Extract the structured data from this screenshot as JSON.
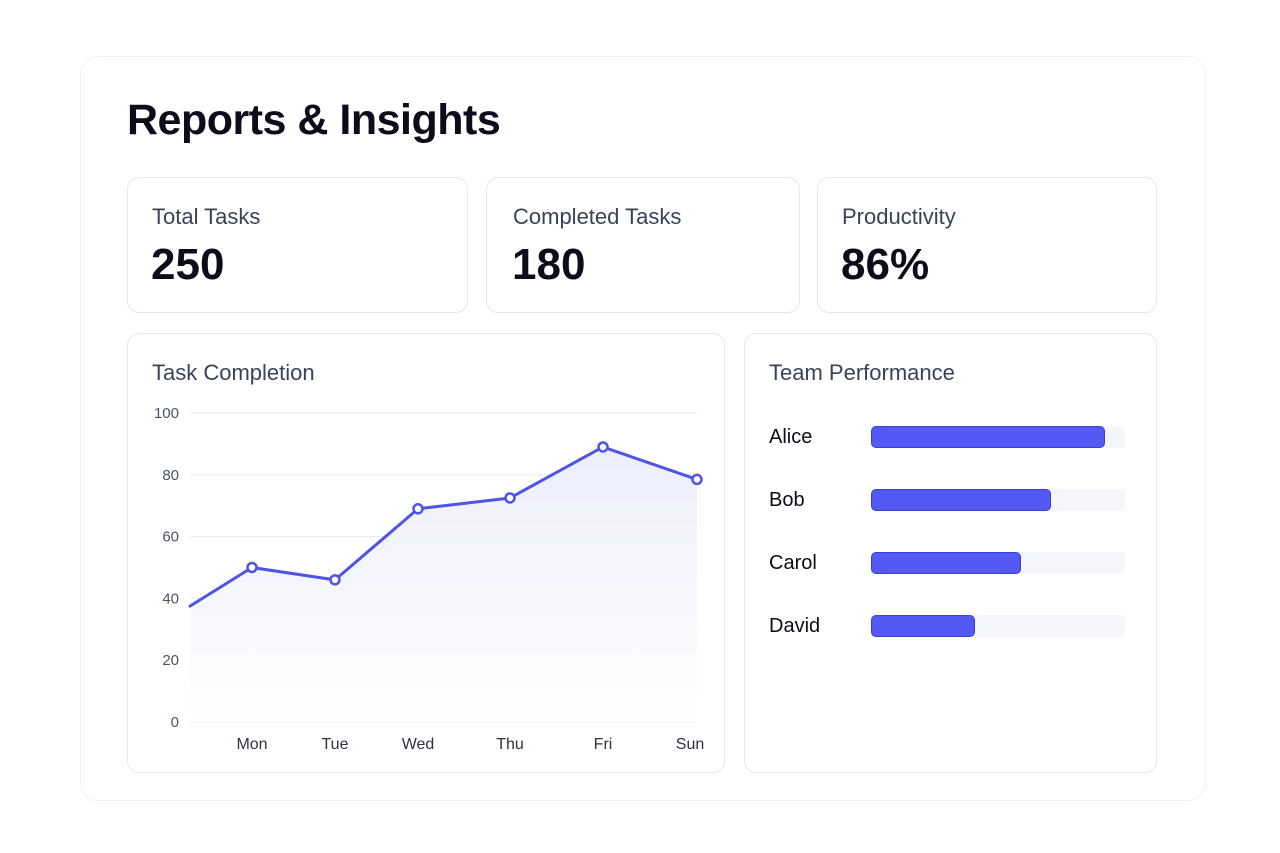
{
  "page": {
    "title": "Reports & Insights"
  },
  "stats": [
    {
      "label": "Total Tasks",
      "value": "250"
    },
    {
      "label": "Completed Tasks",
      "value": "180"
    },
    {
      "label": "Productivity",
      "value": "86%"
    }
  ],
  "task_completion": {
    "title": "Task Completion"
  },
  "chart_data": {
    "type": "area",
    "categories": [
      "Mon",
      "Tue",
      "Wed",
      "Thu",
      "Fri",
      "Sun"
    ],
    "series": [
      {
        "values": [
          50,
          46,
          69,
          72.5,
          89,
          78.5
        ]
      }
    ],
    "leading_value": 37.5,
    "ylim": [
      0,
      100
    ],
    "yticks": [
      0,
      20,
      40,
      60,
      80,
      100
    ],
    "grid": true,
    "line_color": "#4f54e6",
    "fill_color": "#eef0fb"
  },
  "team_performance": {
    "title": "Team Performance",
    "members": [
      {
        "name": "Alice",
        "progress": 0.92
      },
      {
        "name": "Bob",
        "progress": 0.71
      },
      {
        "name": "Carol",
        "progress": 0.59
      },
      {
        "name": "David",
        "progress": 0.41
      }
    ],
    "bar_color": "#5559f3"
  }
}
